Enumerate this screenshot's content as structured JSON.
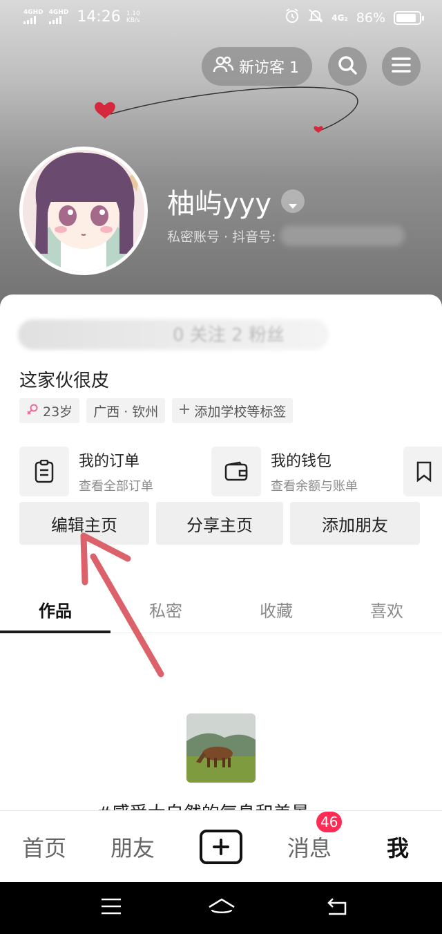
{
  "status_bar": {
    "signal_1": "4GHD",
    "signal_2": "4GHD",
    "time": "14:26",
    "net_speed_value": "1.10",
    "net_speed_unit": "KB/s",
    "network_type": "4G₂",
    "battery_percent": "86%",
    "battery_level": 0.86
  },
  "header": {
    "visitor_button_label": "新访客 1",
    "icons": [
      "users-icon",
      "search-icon",
      "menu-icon"
    ]
  },
  "profile": {
    "username": "柚屿yyy",
    "account_info": "私密账号 · 抖音号:",
    "stats_partial": "0 关注   2 粉丝",
    "bio": "这家伙很皮",
    "tags": [
      {
        "icon": "female-icon",
        "label": "23岁"
      },
      {
        "icon": "",
        "label": "广西 · 钦州"
      },
      {
        "icon": "plus-icon",
        "label": "添加学校等标签"
      }
    ]
  },
  "services": [
    {
      "icon": "order-icon",
      "title": "我的订单",
      "subtitle": "查看全部订单"
    },
    {
      "icon": "wallet-icon",
      "title": "我的钱包",
      "subtitle": "查看余额与账单"
    }
  ],
  "actions": {
    "edit": "编辑主页",
    "share": "分享主页",
    "add_friend": "添加朋友"
  },
  "tabs": [
    "作品",
    "私密",
    "收藏",
    "喜欢"
  ],
  "active_tab": "作品",
  "content": {
    "hashtag_partial": "#感受大自然的气息和美景"
  },
  "bottom_nav": {
    "home": "首页",
    "friends": "朋友",
    "messages": "消息",
    "messages_badge": "46",
    "me": "我"
  },
  "colors": {
    "badge": "#fe2c55",
    "arrow": "#d95a62",
    "heart": "#d6283d"
  }
}
